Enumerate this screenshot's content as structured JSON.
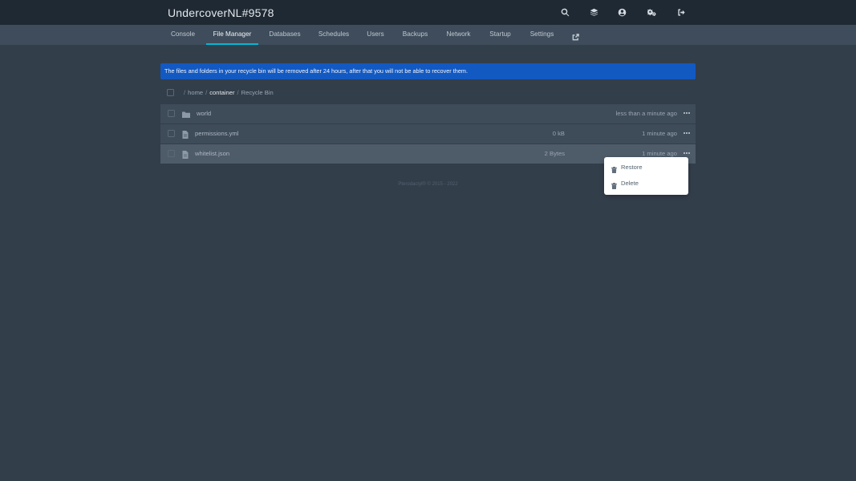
{
  "header": {
    "server_name": "UndercoverNL#9578",
    "icons": [
      "search-icon",
      "layers-icon",
      "user-circle-icon",
      "cogs-icon",
      "sign-out-icon"
    ]
  },
  "nav": {
    "tabs": [
      {
        "label": "Console"
      },
      {
        "label": "File Manager",
        "active": true
      },
      {
        "label": "Databases"
      },
      {
        "label": "Schedules"
      },
      {
        "label": "Users"
      },
      {
        "label": "Backups"
      },
      {
        "label": "Network"
      },
      {
        "label": "Startup"
      },
      {
        "label": "Settings"
      }
    ],
    "external_icon": "external-link-icon",
    "active_color": "#06b6d4"
  },
  "alert": {
    "text": "The files and folders in your recycle bin will be removed after 24 hours, after that you will not be able to recover them.",
    "color": "#1359c2"
  },
  "breadcrumb": {
    "separator": "/",
    "parts": [
      "home",
      "container",
      "Recycle Bin"
    ]
  },
  "files": [
    {
      "name": "world",
      "type": "folder",
      "size": "",
      "modified": "less than a minute ago"
    },
    {
      "name": "permissions.yml",
      "type": "file",
      "size": "0 kB",
      "modified": "1 minute ago"
    },
    {
      "name": "whitelist.json",
      "type": "file",
      "size": "2 Bytes",
      "modified": "1 minute ago"
    }
  ],
  "context_menu": {
    "items": [
      {
        "label": "Restore",
        "icon": "trash-icon"
      },
      {
        "label": "Delete",
        "icon": "trash-icon"
      }
    ]
  },
  "footer": {
    "text": "Pterodactyl® © 2015 - 2022"
  }
}
